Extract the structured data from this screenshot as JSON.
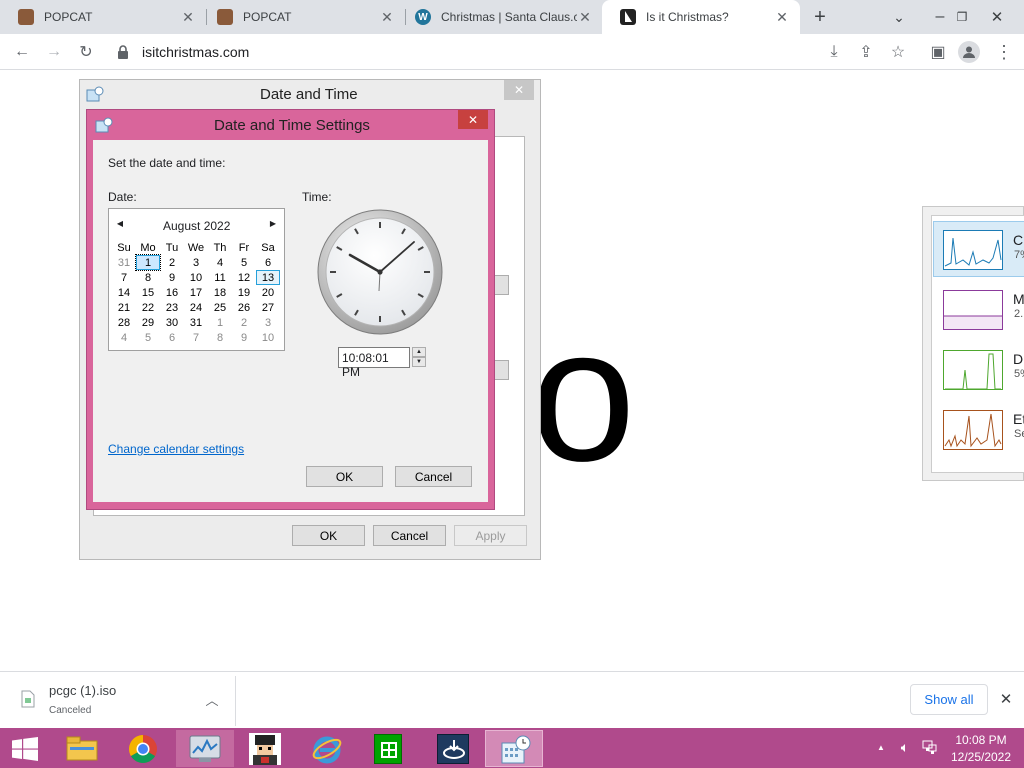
{
  "browser": {
    "tabs": [
      {
        "title": "POPCAT",
        "icon": "popcat-favicon"
      },
      {
        "title": "POPCAT",
        "icon": "popcat-favicon"
      },
      {
        "title": "Christmas | Santa Claus.c",
        "icon": "wordpress-favicon"
      },
      {
        "title": "Is it Christmas?",
        "icon": "tree-favicon",
        "active": true
      }
    ],
    "url": "isitchristmas.com",
    "page_big_text": "o"
  },
  "outer_dialog": {
    "title": "Date and Time",
    "ok": "OK",
    "cancel": "Cancel",
    "apply": "Apply"
  },
  "inner_dialog": {
    "title": "Date and Time Settings",
    "instruction": "Set the date and time:",
    "date_label": "Date:",
    "time_label": "Time:",
    "month": "August 2022",
    "weekdays": [
      "Su",
      "Mo",
      "Tu",
      "We",
      "Th",
      "Fr",
      "Sa"
    ],
    "weeks": [
      [
        "31",
        "1",
        "2",
        "3",
        "4",
        "5",
        "6"
      ],
      [
        "7",
        "8",
        "9",
        "10",
        "11",
        "12",
        "13"
      ],
      [
        "14",
        "15",
        "16",
        "17",
        "18",
        "19",
        "20"
      ],
      [
        "21",
        "22",
        "23",
        "24",
        "25",
        "26",
        "27"
      ],
      [
        "28",
        "29",
        "30",
        "31",
        "1",
        "2",
        "3"
      ],
      [
        "4",
        "5",
        "6",
        "7",
        "8",
        "9",
        "10"
      ]
    ],
    "selected_day": "1",
    "today_day": "13",
    "time_value": "10:08:01 PM",
    "change_calendar_link": "Change calendar settings",
    "ok": "OK",
    "cancel": "Cancel"
  },
  "perf_panel": {
    "items": [
      {
        "label": "C",
        "sub": "7%",
        "color": "#1b7bb5"
      },
      {
        "label": "M",
        "sub": "2.",
        "color": "#8b3a9b"
      },
      {
        "label": "D",
        "sub": "5%",
        "color": "#4ea72e"
      },
      {
        "label": "Et",
        "sub": "Se",
        "color": "#a7521d"
      }
    ]
  },
  "download": {
    "filename": "pcgc (1).iso",
    "status": "Canceled",
    "show_all": "Show all"
  },
  "taskbar": {
    "clock_time": "10:08 PM",
    "clock_date": "12/25/2022"
  },
  "colors": {
    "inner_border": "#d9659b",
    "taskbar": "#b04a8c",
    "link": "#0066cc"
  }
}
